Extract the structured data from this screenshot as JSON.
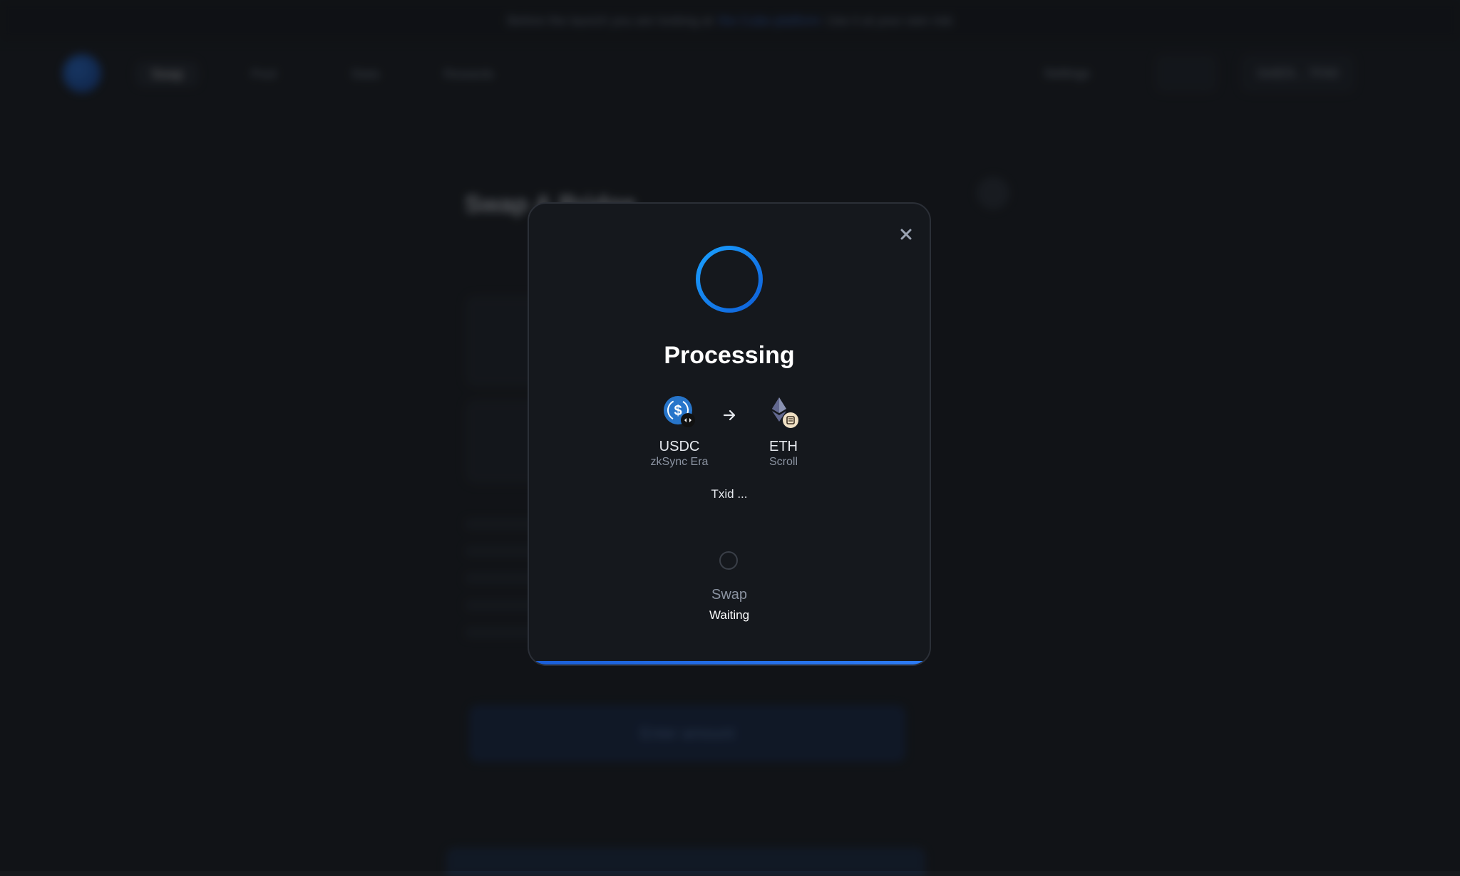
{
  "background": {
    "banner_text_left": "Before the launch you are looking at",
    "banner_link": "the Cube platform",
    "banner_text_right": "Use it at your own risk",
    "nav_tabs": [
      "Swap",
      "Pool",
      "Stats",
      "Rewards"
    ],
    "settings_label": "Settings",
    "wallet_label": "0x6E9... 7FA9",
    "page_title": "Swap & Bridge",
    "enter_amount_label": "Enter amount"
  },
  "modal": {
    "title": "Processing",
    "from_token": {
      "symbol": "USDC",
      "chain": "zkSync Era",
      "icon": "usdc-icon"
    },
    "to_token": {
      "symbol": "ETH",
      "chain": "Scroll",
      "icon": "eth-icon"
    },
    "txid": "Txid ...",
    "step": {
      "label": "Swap",
      "status": "Waiting"
    },
    "progress": 1.0,
    "colors": {
      "accent": "#1a74e8",
      "spinner": "#1a8cff",
      "usdc": "#2775ca"
    }
  }
}
